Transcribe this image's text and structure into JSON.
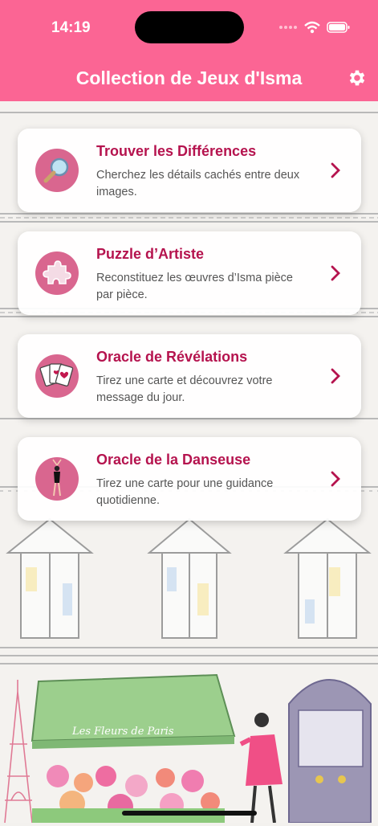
{
  "status_bar": {
    "time": "14:19"
  },
  "header": {
    "title": "Collection de Jeux d'Isma",
    "settings_icon": "gear-icon"
  },
  "games": [
    {
      "title": "Trouver les Différences",
      "description": "Cherchez les détails cachés entre deux images.",
      "icon": "magnifier-icon"
    },
    {
      "title": "Puzzle d’Artiste",
      "description": "Reconstituez les œuvres d’Isma pièce par pièce.",
      "icon": "puzzle-icon"
    },
    {
      "title": "Oracle de Révélations",
      "description": "Tirez une carte et découvrez votre message du jour.",
      "icon": "cards-icon"
    },
    {
      "title": "Oracle de la Danseuse",
      "description": "Tirez une carte pour une guidance quotidienne.",
      "icon": "dancer-icon"
    }
  ],
  "background": {
    "shop_sign": "Les Fleurs de Paris"
  },
  "colors": {
    "header": "#fb6594",
    "accent": "#b5134e",
    "icon_bg": "#d9668f"
  }
}
